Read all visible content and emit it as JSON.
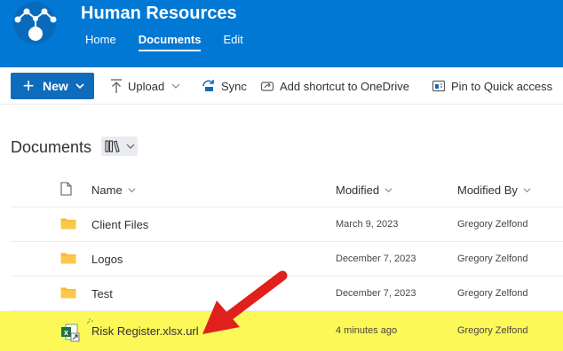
{
  "site": {
    "title": "Human Resources",
    "nav": [
      {
        "label": "Home",
        "active": false
      },
      {
        "label": "Documents",
        "active": true
      },
      {
        "label": "Edit",
        "active": false
      }
    ],
    "header_color": "#0078d4"
  },
  "commands": {
    "new_label": "New",
    "upload_label": "Upload",
    "sync_label": "Sync",
    "add_shortcut_label": "Add shortcut to OneDrive",
    "pin_label": "Pin to Quick access"
  },
  "library": {
    "title": "Documents",
    "columns": {
      "name": "Name",
      "modified": "Modified",
      "modified_by": "Modified By"
    },
    "rows": [
      {
        "name": "Client Files",
        "modified": "March 9, 2023",
        "modified_by": "Gregory Zelfond",
        "type": "folder"
      },
      {
        "name": "Logos",
        "modified": "December 7, 2023",
        "modified_by": "Gregory Zelfond",
        "type": "folder"
      },
      {
        "name": "Test",
        "modified": "December 7, 2023",
        "modified_by": "Gregory Zelfond",
        "type": "folder"
      },
      {
        "name": "Risk Register.xlsx.url",
        "modified": "4 minutes ago",
        "modified_by": "Gregory Zelfond",
        "type": "excel-link",
        "highlighted": true
      }
    ]
  },
  "colors": {
    "accent": "#0f6cbd",
    "highlight": "#fbf858",
    "annotation_arrow": "#e0201c",
    "folder": "#f6b93b",
    "excel": "#1e7145"
  }
}
